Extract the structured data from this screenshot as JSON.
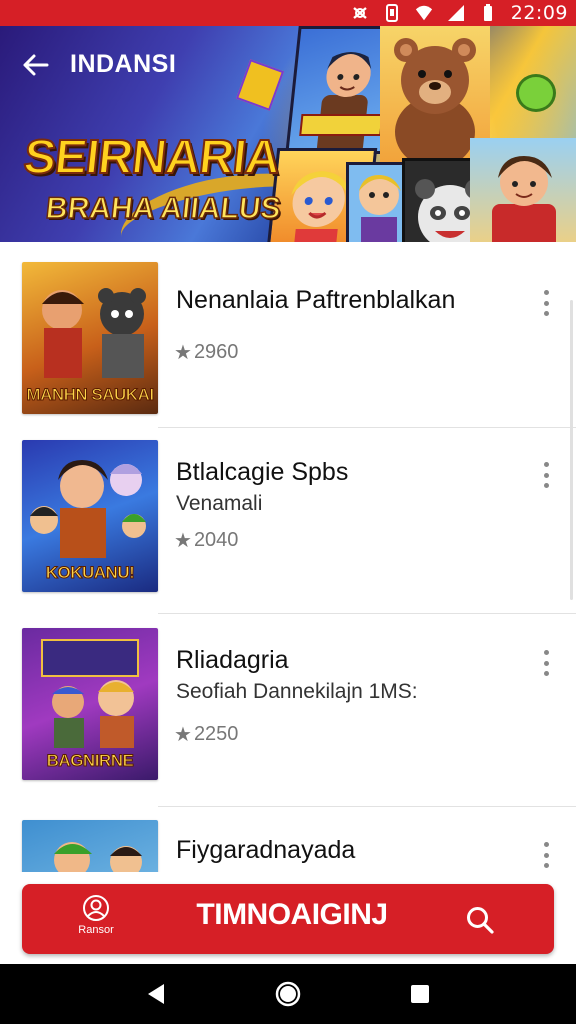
{
  "status_bar": {
    "time": "22:09",
    "icons": [
      "notification-icon",
      "vibrate-icon",
      "wifi-icon",
      "signal-icon",
      "battery-icon"
    ]
  },
  "header": {
    "back_icon": "arrow-left-icon",
    "label": "INDANSI",
    "title": "SEIRNARIA",
    "subtitle": "BRAHA AIIALUS"
  },
  "list": {
    "items": [
      {
        "title": "Nenanlaia Paftrenblalkan",
        "subtitle": "",
        "rating": "2960",
        "thumb_caption": "MANHN SAUKAI",
        "theme": "#b8741f"
      },
      {
        "title": "Btlalcagie Spbs",
        "subtitle": "Venamali",
        "rating": "2040",
        "thumb_caption": "KOKUANU!",
        "theme": "#2b4cc0"
      },
      {
        "title": "Rliadagria",
        "subtitle": "Seofiah Dannekilajn 1MS:",
        "rating": "2250",
        "thumb_caption": "BAGNIRNE",
        "theme": "#5a2a9a"
      },
      {
        "title": "Fiygaradnayada",
        "subtitle": "",
        "rating": "",
        "thumb_caption": "",
        "theme": "#3f8fd0"
      }
    ]
  },
  "bottom_bar": {
    "left_label": "Ransor",
    "left_icon": "person-icon",
    "main_label": "TIMNOAIGINJ",
    "search_icon": "search-icon",
    "color": "#d61f26"
  },
  "nav": {
    "icons": [
      "back-triangle-icon",
      "home-circle-icon",
      "recents-square-icon"
    ]
  }
}
